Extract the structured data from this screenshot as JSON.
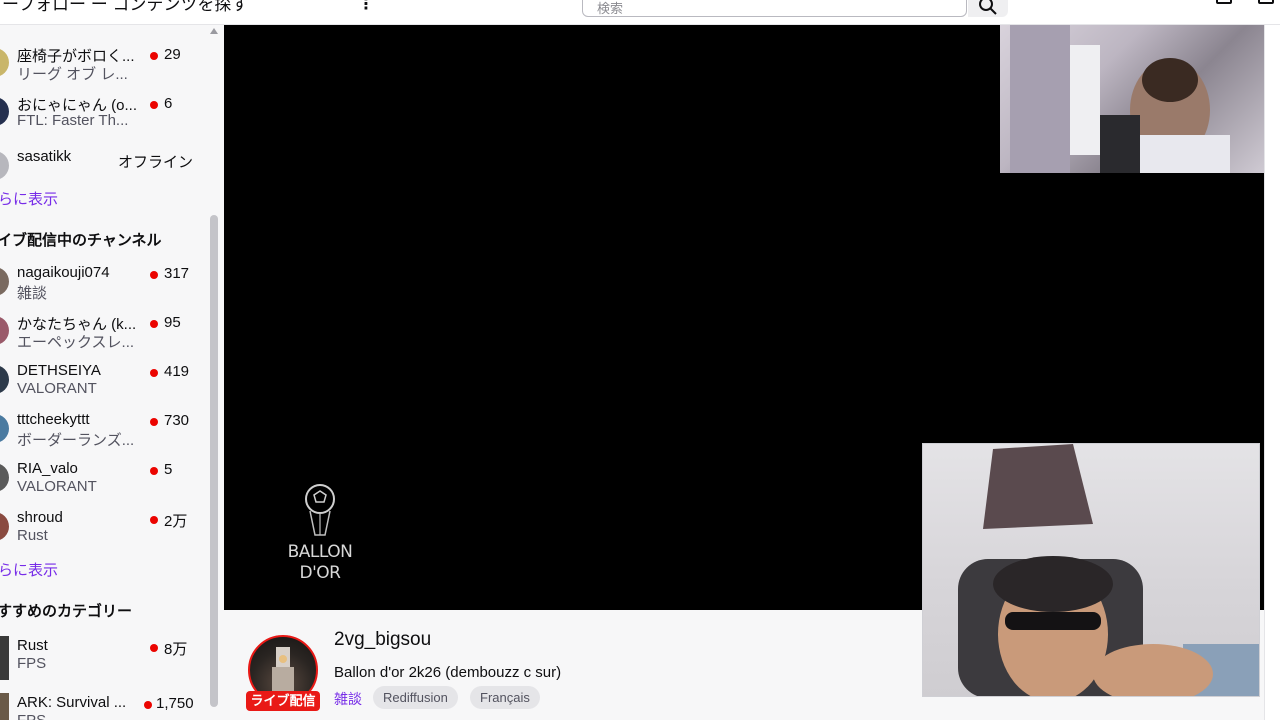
{
  "topbar": {
    "nav_text": "ーフォロー ー コンテンツを探す",
    "more_label": "⋮",
    "search_placeholder": "検索"
  },
  "sidebar": {
    "followed": [
      {
        "name": "座椅子がボロく...",
        "sub": "リーグ オブ レ...",
        "viewers": "29",
        "live": true,
        "avatar_color": "#c9b66a"
      },
      {
        "name": "おにゃにゃん (o...",
        "sub": "FTL: Faster Th...",
        "viewers": "6",
        "live": true,
        "avatar_color": "#25304f"
      },
      {
        "name": "sasatikk",
        "sub": "",
        "status": "オフライン",
        "live": false,
        "avatar_color": "#b7b7bd"
      }
    ],
    "show_more_1": "らに表示",
    "live_section_title": "イブ配信中のチャンネル",
    "live_channels": [
      {
        "name": "nagaikouji074",
        "sub": "雑談",
        "viewers": "317",
        "avatar_color": "#7a6a60"
      },
      {
        "name": "かなたちゃん (k...",
        "sub": "エーペックスレ...",
        "viewers": "95",
        "avatar_color": "#9a5a6a"
      },
      {
        "name": "DETHSEIYA",
        "sub": "VALORANT",
        "viewers": "419",
        "avatar_color": "#2d3a4a"
      },
      {
        "name": "tttcheekyttt",
        "sub": "ボーダーランズ...",
        "viewers": "730",
        "avatar_color": "#4a7aa0"
      },
      {
        "name": "RIA_valo",
        "sub": "VALORANT",
        "viewers": "5",
        "avatar_color": "#5a5a5a"
      },
      {
        "name": "shroud",
        "sub": "Rust",
        "viewers": "2万",
        "avatar_color": "#8a4a40"
      }
    ],
    "show_more_2": "らに表示",
    "category_section_title": "すすめのカテゴリー",
    "categories": [
      {
        "name": "Rust",
        "sub": "FPS",
        "viewers": "8万"
      },
      {
        "name": "ARK: Survival ...",
        "sub": "FPS",
        "viewers": "1,750"
      }
    ]
  },
  "video": {
    "logo_line1": "BALLON",
    "logo_line2": "D'OR"
  },
  "stream_info": {
    "channel_name": "2vg_bigsou",
    "title": "Ballon d'or 2k26 (dembouzz c sur)",
    "category": "雑談",
    "tags": [
      "Rediffusion",
      "Français"
    ],
    "live_badge": "ライブ配信"
  },
  "colors": {
    "accent": "#772ce8",
    "live_red": "#eb0400",
    "badge_red": "#e91916"
  }
}
